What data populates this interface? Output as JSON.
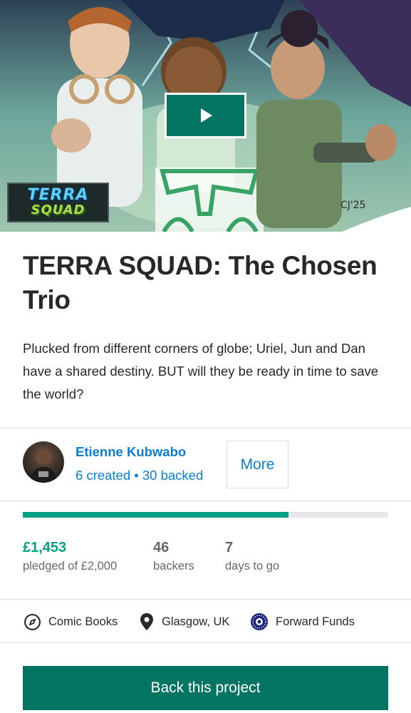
{
  "hero": {
    "logo_line1": "TERRA",
    "logo_line2": "SQUAD",
    "signature": "CJ'25",
    "play_icon": "play-icon"
  },
  "project": {
    "title": "TERRA SQUAD: The Chosen Trio",
    "blurb": "Plucked from different corners of globe; Uriel, Jun and Dan have a shared destiny. BUT will they be ready in time to save the world?"
  },
  "creator": {
    "name": "Etienne Kubwabo",
    "stats": "6 created • 30 backed",
    "more_label": "More"
  },
  "funding": {
    "progress_fraction": 0.7265,
    "pledged_value": "£1,453",
    "pledged_label": "pledged of £2,000",
    "backers_value": "46",
    "backers_label": "backers",
    "days_value": "7",
    "days_label": "days to go"
  },
  "meta": {
    "category": "Comic Books",
    "category_icon": "compass-icon",
    "location": "Glasgow, UK",
    "location_icon": "map-pin-icon",
    "funding_type": "Forward Funds",
    "funding_icon": "forward-funds-icon"
  },
  "cta": {
    "back_label": "Back this project"
  },
  "colors": {
    "accent_green": "#05a081",
    "button_green": "#037362",
    "link_blue": "#0b7fcf",
    "text_dark": "#282828",
    "text_muted": "#656969"
  }
}
